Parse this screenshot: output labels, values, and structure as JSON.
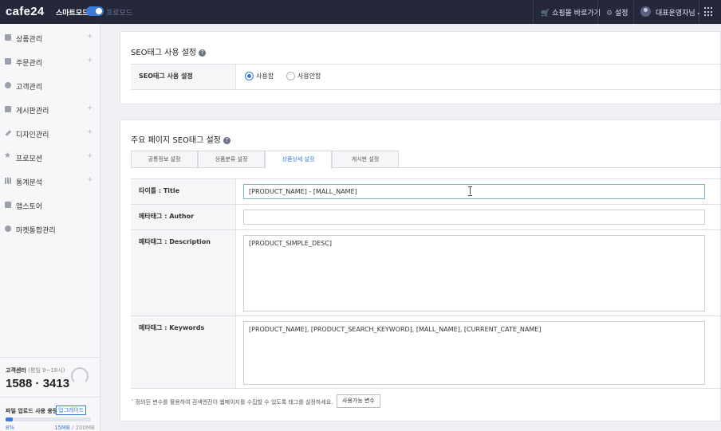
{
  "header": {
    "logo": "cafe24",
    "smart_mode": "스마트모드",
    "pro_mode": "프로모드",
    "shop_link": "쇼핑몰 바로가기",
    "settings": "설정",
    "user": "대표운영자님"
  },
  "sidebar": {
    "items": [
      {
        "label": "상품관리",
        "expandable": "+"
      },
      {
        "label": "주문관리",
        "expandable": "+"
      },
      {
        "label": "고객관리",
        "expandable": ""
      },
      {
        "label": "게시판관리",
        "expandable": "+"
      },
      {
        "label": "디자인관리",
        "expandable": "+"
      },
      {
        "label": "프로모션",
        "expandable": "+"
      },
      {
        "label": "통계분석",
        "expandable": "+"
      },
      {
        "label": "앱스토어",
        "expandable": ""
      },
      {
        "label": "마켓통합관리",
        "expandable": ""
      }
    ],
    "customer_center": {
      "label": "고객센터",
      "hours": "(평일 9~18시)",
      "phone": "1588 · 3413"
    },
    "upload": {
      "label": "파일 업로드 사용 용량",
      "badge": "업그레이드",
      "percent_text": "8%",
      "percent": 8,
      "used": "15MB",
      "total": "/ 200MB"
    }
  },
  "seo_setting": {
    "title": "SEO태그 사용 설정",
    "row_label": "SEO태그 사용 설정",
    "options": [
      {
        "label": "사용함",
        "selected": true
      },
      {
        "label": "사용안함",
        "selected": false
      }
    ]
  },
  "page_seo": {
    "title": "주요 페이지 SEO태그 설정",
    "tabs": [
      {
        "label": "공통정보 설정",
        "active": false
      },
      {
        "label": "상품분류 설정",
        "active": false
      },
      {
        "label": "상품상세 설정",
        "active": true
      },
      {
        "label": "게시판 설정",
        "active": false
      }
    ],
    "fields": {
      "title": {
        "label": "타이틀 : Title",
        "value": "[PRODUCT_NAME] - [MALL_NAME]"
      },
      "author": {
        "label": "메타태그 : Author",
        "value": ""
      },
      "description": {
        "label": "메타태그 : Description",
        "value": "[PRODUCT_SIMPLE_DESC]"
      },
      "keywords": {
        "label": "메타태그 : Keywords",
        "value": "[PRODUCT_NAME], [PRODUCT_SEARCH_KEYWORD], [MALL_NAME], [CURRENT_CATE_NAME]"
      }
    },
    "note": "정의된 변수를 활용하여 검색엔진이 웹페이지를 수집할 수 있도록 태그를 설정하세요.",
    "var_button": "사용가능 변수"
  },
  "colors": {
    "topbar": "#25283a",
    "accent": "#3a7bd5"
  }
}
